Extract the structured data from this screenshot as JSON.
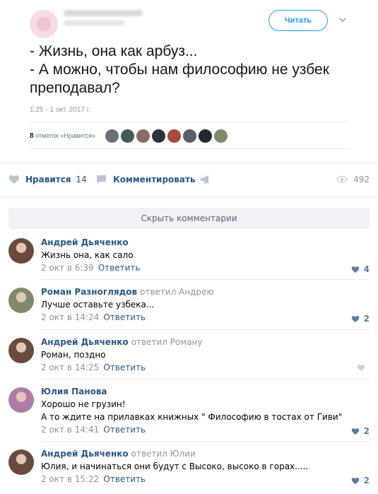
{
  "tweet": {
    "read_button": "Читать",
    "lines": [
      "- Жизнь, она как арбуз...",
      "- А можно, чтобы нам философию не узбек",
      "преподавал?"
    ],
    "timestamp": "1:25 - 1 окт. 2017 г.",
    "likes_count": "8",
    "likes_label": "отметок «Нравится»",
    "liker_colors": [
      "#6b6f78",
      "#3f5f56",
      "#8a6e62",
      "#2f3338",
      "#a44a3f",
      "#5a5e66",
      "#24282e",
      "#7e8a6a"
    ]
  },
  "actions": {
    "like_label": "Нравится",
    "like_count": "14",
    "comment_label": "Комментировать",
    "views": "492"
  },
  "hide_comments": "Скрыть комментарии",
  "comments": [
    {
      "author": "Андрей Дьяченко",
      "reply_to": "",
      "text": [
        "Жизнь она, как сало"
      ],
      "time": "2 окт в 6:39",
      "reply": "Ответить",
      "likes": "4",
      "liked": true,
      "avatar_color": "#6a4a3c"
    },
    {
      "author": "Роман Разноглядов",
      "reply_to": "ответил Андрею",
      "text": [
        "Лучше оставьте узбека..."
      ],
      "time": "2 окт в 14:24",
      "reply": "Ответить",
      "likes": "2",
      "liked": true,
      "avatar_color": "#7f8a6b"
    },
    {
      "author": "Андрей Дьяченко",
      "reply_to": "ответил Роману",
      "text": [
        "Роман, поздно"
      ],
      "time": "2 окт в 14:25",
      "reply": "Ответить",
      "likes": "",
      "liked": false,
      "avatar_color": "#6a4a3c"
    },
    {
      "author": "Юлия Панова",
      "reply_to": "",
      "text": [
        "Хорошо не грузин!",
        "А то ждите на прилавках книжных \" Философию в тостах от Гиви\""
      ],
      "time": "2 окт в 14:41",
      "reply": "Ответить",
      "likes": "2",
      "liked": true,
      "avatar_color": "#b07aa8"
    },
    {
      "author": "Андрей Дьяченко",
      "reply_to": "ответил Юлии",
      "text": [
        "Юлия, и начинаться они будут с Высоко, высоко в горах....."
      ],
      "time": "2 окт в 15:22",
      "reply": "Ответить",
      "likes": "2",
      "liked": true,
      "avatar_color": "#6a4a3c"
    }
  ]
}
